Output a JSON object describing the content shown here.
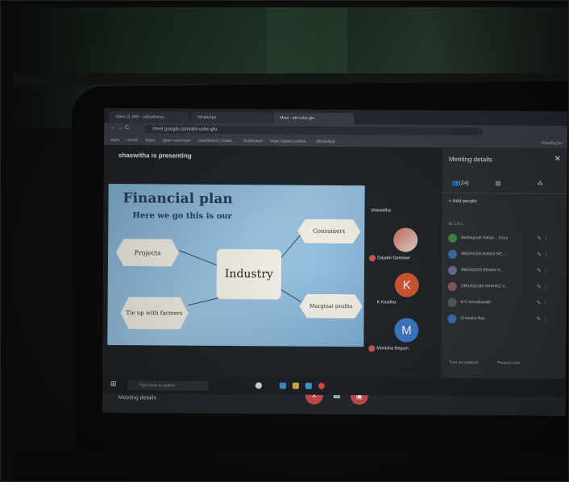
{
  "browser": {
    "tabs": [
      {
        "label": "Inbox (2,199) - sahyabarva..."
      },
      {
        "label": "WhatsApp"
      },
      {
        "label": "Meet - ahi-vchc-gtu"
      }
    ],
    "url": "meet.google.com/ahi-vchc-gfu",
    "bookmarks": [
      "Apps",
      "Gmail",
      "Maps",
      "gitam web login",
      "Dashboard | Gitam...",
      "Dashboard",
      "https://gitam.codeta...",
      "WhatsApp"
    ],
    "reading_list": "Reading list"
  },
  "meet": {
    "presenting": "shaswitha is presenting",
    "meeting_details": "Meeting details",
    "participants_tiles": [
      {
        "name": "shaswitha"
      },
      {
        "name": "Gayatri Gamreer"
      },
      {
        "name": "K Kavitha",
        "initial": "K",
        "color": "#d3542f"
      },
      {
        "name": "Monisha Begum",
        "initial": "M",
        "color": "#3a79c9"
      }
    ],
    "bottom_buttons": [
      "Turn on captions",
      "Present now"
    ]
  },
  "slide": {
    "title": "Financial plan",
    "subtitle": "Here we go this is our",
    "center": "Industry",
    "nodes": [
      "Projects",
      "Consumers",
      "Tie up with farmers",
      "Marginal profits"
    ]
  },
  "panel": {
    "title": "Meeting details",
    "tabs": [
      "(24)",
      "",
      ""
    ],
    "add_people": "Add people",
    "in_call": "IN CALL",
    "people": [
      {
        "name": "Bathogoudi Sahas... (You)",
        "color": "#3f8a4a"
      },
      {
        "name": "9902A0205 BANDI NE...",
        "color": "#3a6fb0"
      },
      {
        "name": "9902A0203 DEVAM K...",
        "color": "#6b6f9a"
      },
      {
        "name": "2301A0218A NIHARIZ V...",
        "color": "#8a5b5b"
      },
      {
        "name": "B C Amruthavalli",
        "color": "#555b61"
      },
      {
        "name": "Chandini Rao",
        "color": "#3a6fb0"
      }
    ]
  },
  "taskbar": {
    "search": "Type here to search"
  },
  "colors": {
    "slide_bg": "#8fbddf",
    "end_call": "#d24b4b"
  }
}
